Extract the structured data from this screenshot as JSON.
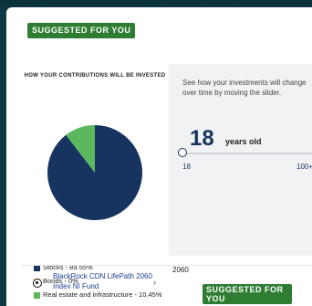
{
  "suggested_badge_top": "SUGGESTED FOR YOU",
  "chart": {
    "title": "HOW YOUR CONTRIBUTIONS WILL BE INVESTED"
  },
  "chart_data": {
    "type": "pie",
    "categories": [
      "Stocks",
      "Bonds",
      "Real estate and infrastructure"
    ],
    "values": [
      89.55,
      0,
      10.45
    ],
    "colors": [
      "#17335f",
      "#f5d547",
      "#5cb85c"
    ],
    "legend_placement": "bottom"
  },
  "legend": [
    {
      "label": "Stocks - 89.55%",
      "color": "#17335f"
    },
    {
      "label": "Bonds - 0%",
      "color": "#f5d547"
    },
    {
      "label": "Real estate and infrastructure - 10.45%",
      "color": "#5cb85c"
    }
  ],
  "slider": {
    "description": "See how your investments will change over time by moving the slider.",
    "age_value": "18",
    "age_label": "years old",
    "min_label": "18",
    "max_label": "100+",
    "fraction": 0
  },
  "fund": {
    "name": "BlackRock CDN LifePath 2060 Index NI Fund",
    "chevron": "›",
    "year": "2060",
    "badge": "SUGGESTED FOR YOU"
  },
  "colors": {
    "background": "#0e3a44",
    "badge": "#2e7d32",
    "primary": "#17335f",
    "link": "#1a3e8f"
  }
}
